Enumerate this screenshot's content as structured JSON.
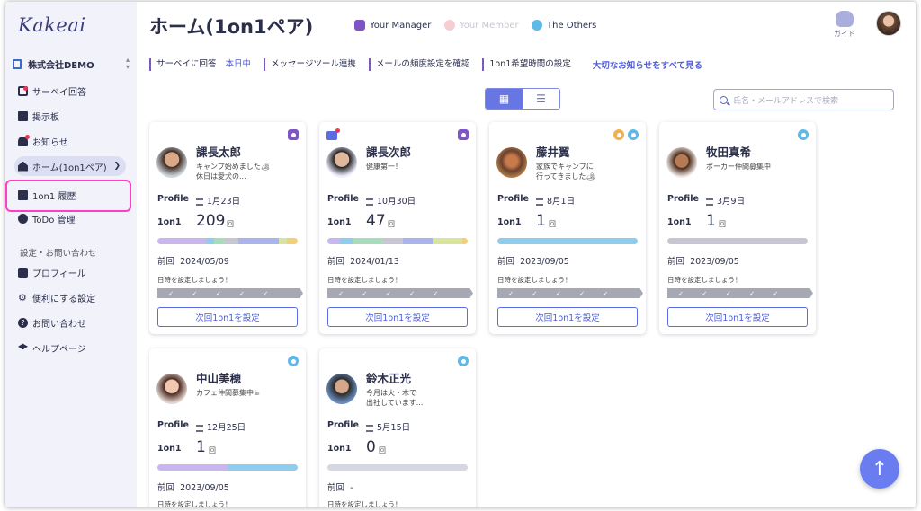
{
  "app": {
    "logo": "Kakeai",
    "company": "株式会社DEMO"
  },
  "sidebar": {
    "items": [
      {
        "label": "サーベイ回答",
        "icon": "survey-icon"
      },
      {
        "label": "掲示板",
        "icon": "board-icon"
      },
      {
        "label": "お知らせ",
        "icon": "bell-icon"
      },
      {
        "label": "ホーム(1on1ペア)",
        "icon": "home-icon"
      },
      {
        "label": "1on1 履歴",
        "icon": "history-icon"
      },
      {
        "label": "ToDo 管理",
        "icon": "check-circle-icon"
      }
    ],
    "section_label": "設定・お問い合わせ",
    "settings": [
      {
        "label": "プロフィール",
        "icon": "profile-icon"
      },
      {
        "label": "便利にする設定",
        "icon": "gear-icon"
      },
      {
        "label": "お問い合わせ",
        "icon": "question-icon"
      },
      {
        "label": "ヘルプページ",
        "icon": "graduation-cap-icon"
      }
    ]
  },
  "header": {
    "title": "ホーム(1on1ペア)",
    "legend": [
      "Your Manager",
      "Your Member",
      "The Others"
    ],
    "guide_label": "ガイド"
  },
  "infobar": {
    "survey": "サーベイに回答",
    "survey_status": "本日中",
    "message_tool": "メッセージツール連携",
    "mail_freq": "メールの頻度設定を確認",
    "hope_time": "1on1希望時間の設定",
    "see_all": "大切なお知らせをすべて見る"
  },
  "search": {
    "placeholder": "氏名・メールアドレスで検索"
  },
  "labels": {
    "profile": "Profile",
    "one_on_one": "1on1",
    "times_unit": "回",
    "prev": "前回",
    "hint": "日時を設定しましょう！",
    "next_button": "次回1on1を設定"
  },
  "cards": [
    {
      "name": "課長太郎",
      "msg1": "キャンプ始めました🏕",
      "msg2": "休日は愛犬の...",
      "birthday": "1月23日",
      "count": "209",
      "prev": "2024/05/09"
    },
    {
      "name": "課長次郎",
      "msg1": "健康第一！",
      "msg2": "",
      "birthday": "10月30日",
      "count": "47",
      "prev": "2024/01/13"
    },
    {
      "name": "藤井翼",
      "msg1": "家族でキャンプに",
      "msg2": "行ってきました🏕",
      "birthday": "8月1日",
      "count": "1",
      "prev": "2023/09/05"
    },
    {
      "name": "牧田真希",
      "msg1": "ポーカー仲間募集中",
      "msg2": "",
      "birthday": "3月9日",
      "count": "1",
      "prev": "2023/09/05"
    },
    {
      "name": "中山美穂",
      "msg1": "カフェ仲間募集中☕",
      "msg2": "",
      "birthday": "12月25日",
      "count": "1",
      "prev": "2023/09/05"
    },
    {
      "name": "鈴木正光",
      "msg1": "今月は火・木で",
      "msg2": "出社しています...",
      "birthday": "5月15日",
      "count": "0",
      "prev": "-"
    }
  ],
  "colors": {
    "accent": "#5b6be0",
    "manager": "#7e55c6",
    "member": "#f2b8c0",
    "others": "#5fb8e6",
    "highlight": "#ff3ec8"
  }
}
